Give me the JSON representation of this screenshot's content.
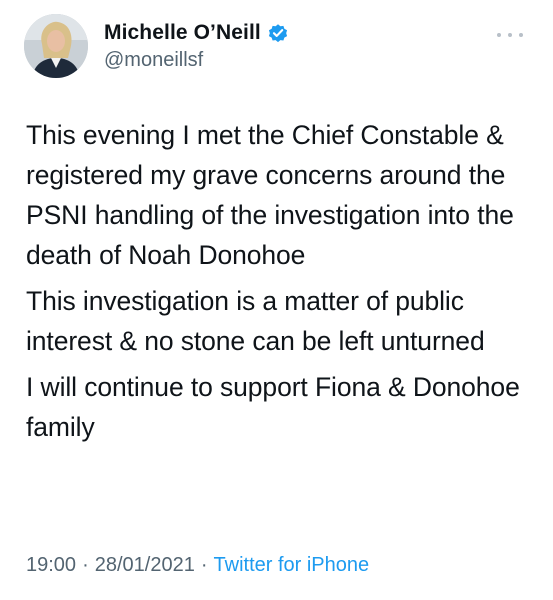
{
  "author": {
    "display_name": "Michelle O’Neill",
    "handle": "@moneillsf",
    "verified": true,
    "avatar_icon": "profile-photo"
  },
  "menu_icon": "more-icon",
  "tweet": {
    "paragraphs": [
      "This evening I met the Chief Constable & registered my grave concerns around the PSNI handling of the investigation into the death of Noah Donohoe",
      "This investigation is a matter of public interest & no stone can be left unturned",
      "I will continue to support Fiona & Donohoe family"
    ]
  },
  "meta": {
    "time": "19:00",
    "separator": "·",
    "date": "28/01/2021",
    "source": "Twitter for iPhone"
  },
  "colors": {
    "text": "#0f1419",
    "secondary": "#536471",
    "accent": "#1d9bf0"
  }
}
